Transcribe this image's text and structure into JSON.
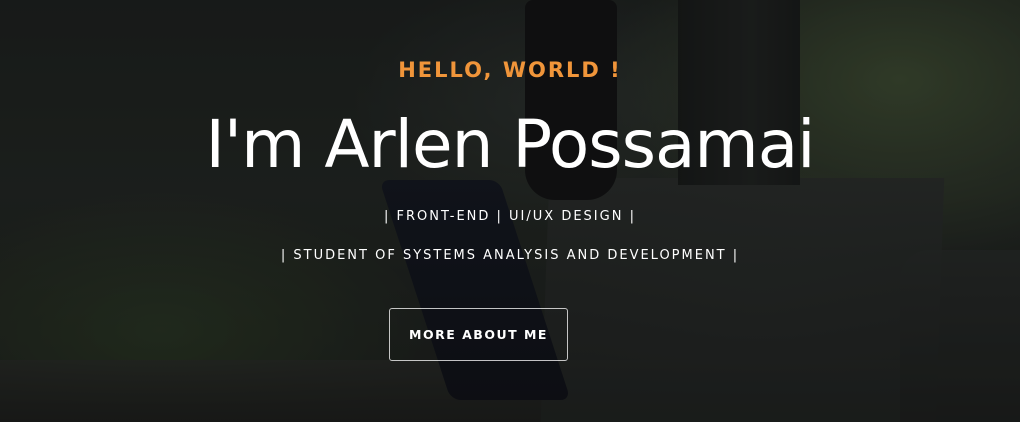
{
  "hero": {
    "greeting": "HELLO, WORLD !",
    "name": "I'm Arlen Possamai",
    "roles": [
      "| FRONT-END | UI/UX DESIGN |",
      "| STUDENT OF SYSTEMS ANALYSIS AND DEVELOPMENT |"
    ],
    "cta_label": "MORE ABOUT ME"
  },
  "colors": {
    "accent": "#f0953a",
    "text": "#ffffff",
    "overlay": "rgba(0,0,0,0.45)"
  }
}
